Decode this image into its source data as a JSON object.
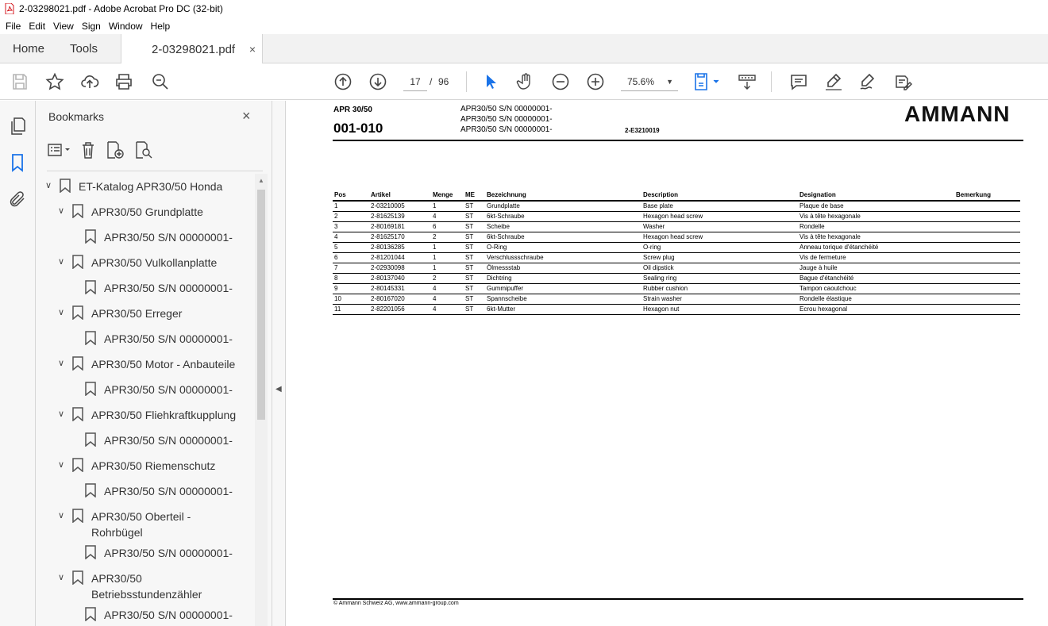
{
  "window": {
    "title": "2-03298021.pdf - Adobe Acrobat Pro DC (32-bit)"
  },
  "menu": [
    "File",
    "Edit",
    "View",
    "Sign",
    "Window",
    "Help"
  ],
  "tabs": {
    "home": "Home",
    "tools": "Tools",
    "doc": "2-03298021.pdf",
    "close": "×"
  },
  "toolbar": {
    "page_current": "17",
    "page_sep": "/",
    "page_total": "96",
    "zoom": "75.6%"
  },
  "bookmarks": {
    "title": "Bookmarks",
    "close": "×",
    "items": [
      {
        "label": "ET-Katalog APR30/50 Honda"
      },
      {
        "label": "APR30/50 Grundplatte"
      },
      {
        "label": "APR30/50 S/N 00000001-"
      },
      {
        "label": "APR30/50 Vulkollanplatte"
      },
      {
        "label": "APR30/50 S/N 00000001-"
      },
      {
        "label": "APR30/50 Erreger"
      },
      {
        "label": "APR30/50 S/N 00000001-"
      },
      {
        "label": "APR30/50 Motor - Anbauteile"
      },
      {
        "label": "APR30/50 S/N 00000001-"
      },
      {
        "label": "APR30/50 Fliehkraftkupplung"
      },
      {
        "label": "APR30/50 S/N 00000001-"
      },
      {
        "label": "APR30/50 Riemenschutz"
      },
      {
        "label": "APR30/50 S/N 00000001-"
      },
      {
        "label_line1": "APR30/50 Oberteil -",
        "label_line2": "Rohrbügel"
      },
      {
        "label": "APR30/50 S/N 00000001-"
      },
      {
        "label_line1": "APR30/50",
        "label_line2": "Betriebsstundenzähler"
      },
      {
        "label": "APR30/50 S/N 00000001-"
      }
    ]
  },
  "document": {
    "model": "APR 30/50",
    "section": "001-010",
    "serials": [
      "APR30/50 S/N 00000001-",
      "APR30/50 S/N 00000001-",
      "APR30/50 S/N 00000001-"
    ],
    "doc_code": "2-E3210019",
    "logo": "AMMANN",
    "columns": [
      "Pos",
      "Artikel",
      "Menge",
      "ME",
      "Bezeichnung",
      "Description",
      "Designation",
      "Bemerkung"
    ],
    "rows": [
      [
        "1",
        "2-03210005",
        "1",
        "ST",
        "Grundplatte",
        "Base plate",
        "Plaque de base",
        ""
      ],
      [
        "2",
        "2-81625139",
        "4",
        "ST",
        "6kt-Schraube",
        "Hexagon head screw",
        "Vis à tête hexagonale",
        ""
      ],
      [
        "3",
        "2-80169181",
        "6",
        "ST",
        "Scheibe",
        "Washer",
        "Rondelle",
        ""
      ],
      [
        "4",
        "2-81625170",
        "2",
        "ST",
        "6kt-Schraube",
        "Hexagon head screw",
        "Vis à tête hexagonale",
        ""
      ],
      [
        "5",
        "2-80136285",
        "1",
        "ST",
        "O-Ring",
        "O-ring",
        "Anneau torique d'étanchéité",
        ""
      ],
      [
        "6",
        "2-81201044",
        "1",
        "ST",
        "Verschlussschraube",
        "Screw plug",
        "Vis de fermeture",
        ""
      ],
      [
        "7",
        "2-02930098",
        "1",
        "ST",
        "Ölmessstab",
        "Oil dipstick",
        "Jauge à huile",
        ""
      ],
      [
        "8",
        "2-80137040",
        "2",
        "ST",
        "Dichtring",
        "Sealing ring",
        "Bague d'étanchéité",
        ""
      ],
      [
        "9",
        "2-80145331",
        "4",
        "ST",
        "Gummipuffer",
        "Rubber cushion",
        "Tampon caoutchouc",
        ""
      ],
      [
        "10",
        "2-80167020",
        "4",
        "ST",
        "Spannscheibe",
        "Strain washer",
        "Rondelle élastique",
        ""
      ],
      [
        "11",
        "2-82201056",
        "4",
        "ST",
        "6kt-Mutter",
        "Hexagon nut",
        "Ecrou hexagonal",
        ""
      ]
    ],
    "footer": "© Ammann Schweiz AG, www.ammann-group.com"
  }
}
